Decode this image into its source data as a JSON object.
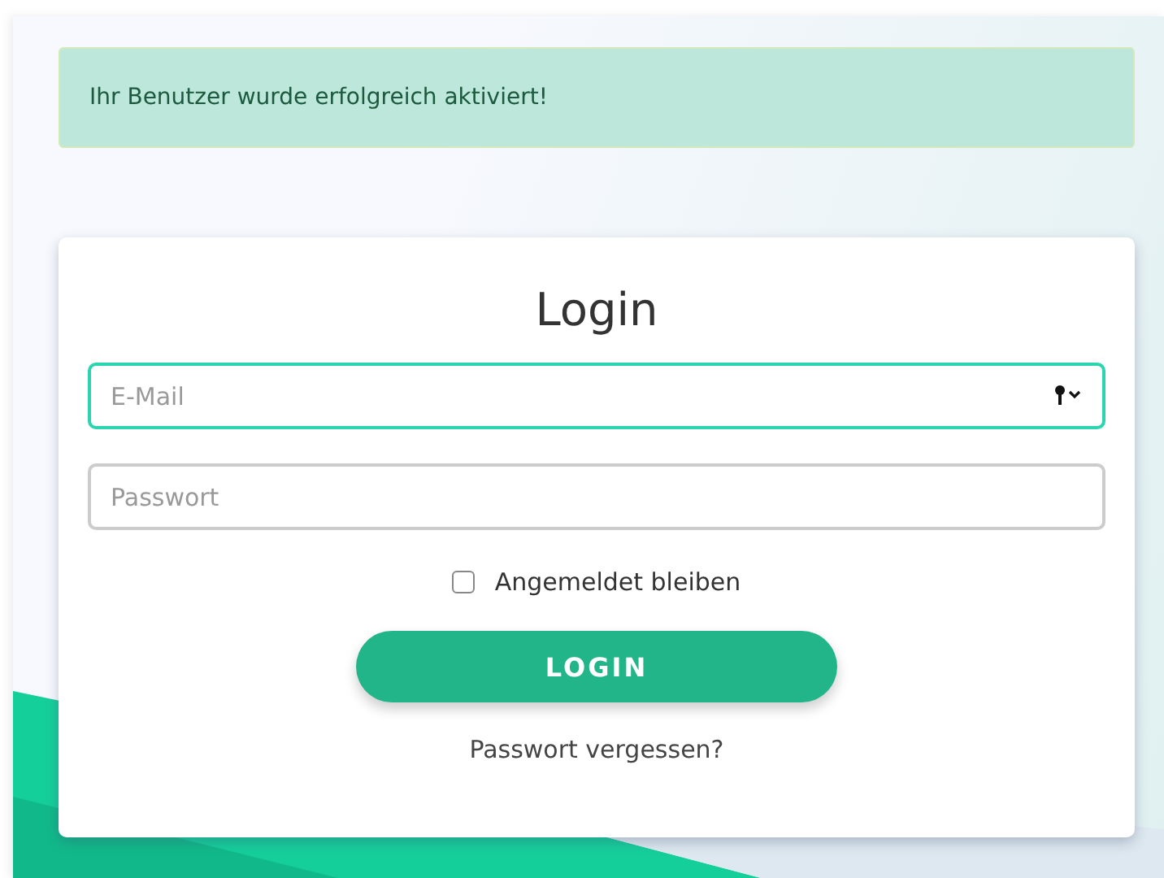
{
  "alert": {
    "text": "Ihr Benutzer wurde erfolgreich aktiviert!"
  },
  "login": {
    "title": "Login",
    "fields": [
      {
        "placeholder": "E-Mail",
        "focused": true,
        "key_icon": true
      },
      {
        "placeholder": "Passwort",
        "focused": false,
        "key_icon": false
      }
    ],
    "remember": {
      "label": "Angemeldet bleiben",
      "checked": false
    },
    "button": "LOGIN",
    "forgot_link": "Passwort vergessen?"
  }
}
